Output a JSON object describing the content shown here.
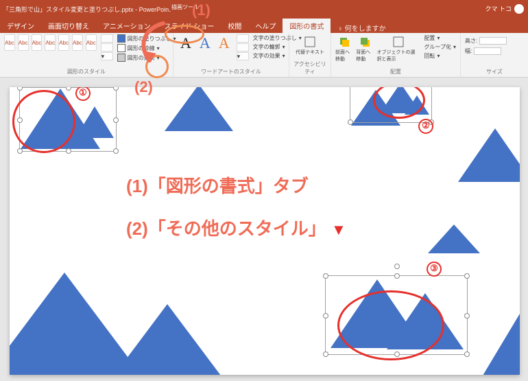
{
  "title": {
    "filename": "「三角形で山」スタイル変更と塗りつぶし.pptx - PowerPoint",
    "toolContext": "描画ツール",
    "user": "クマ トコ"
  },
  "tabs": {
    "items": [
      "デザイン",
      "画面切り替え",
      "アニメーション",
      "スライド ショー",
      "校閲",
      "ヘルプ",
      "図形の書式"
    ],
    "activeIndex": 6,
    "search": "何をしますか"
  },
  "ribbon": {
    "shapeStyles": {
      "label": "図形のスタイル",
      "thumbLabel": "Abc"
    },
    "shapeFill": {
      "fill": "図形の塗りつぶし",
      "outline": "図形の枠線",
      "effect": "図形の効果"
    },
    "wordArt": {
      "label": "ワードアートのスタイル",
      "fill": "文字の塗りつぶし",
      "outline": "文字の輪郭",
      "effect": "文字の効果"
    },
    "access": {
      "label": "アクセシビリティ",
      "alt": "代替テキスト"
    },
    "arrange": {
      "label": "配置",
      "front": "前面へ移動",
      "back": "背面へ移動",
      "select": "オブジェクトの選択と表示",
      "align": "配置",
      "group": "グループ化",
      "rotate": "回転"
    },
    "size": {
      "label": "サイズ",
      "h": "高さ:",
      "w": "幅:"
    }
  },
  "annotations": {
    "topNum1": "(1)",
    "midNum2": "(2)",
    "line1": "(1)「図形の書式」タブ",
    "line2": "(2)「その他のスタイル」",
    "c1": "①",
    "c2": "②",
    "c3": "③"
  }
}
